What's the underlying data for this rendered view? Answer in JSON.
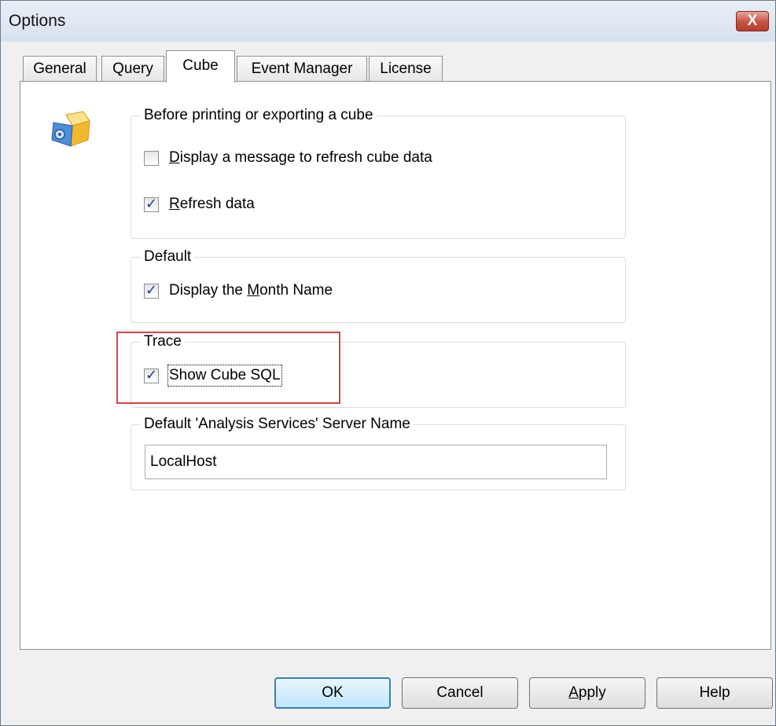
{
  "window": {
    "title": "Options",
    "close_glyph": "X"
  },
  "tabs": [
    {
      "label": "General",
      "active": false
    },
    {
      "label": "Query",
      "active": false
    },
    {
      "label": "Cube",
      "active": true
    },
    {
      "label": "Event Manager",
      "active": false
    },
    {
      "label": "License",
      "active": false
    }
  ],
  "groups": {
    "before_print": {
      "legend": "Before printing or exporting a cube",
      "display_message": {
        "mnemonic": "D",
        "rest": "isplay a message to refresh cube data",
        "checked": false
      },
      "refresh_data": {
        "mnemonic": "R",
        "rest": "efresh data",
        "checked": true
      }
    },
    "default": {
      "legend": "Default",
      "month_name": {
        "pre": "Display the ",
        "mnemonic": "M",
        "rest": "onth Name",
        "checked": true
      }
    },
    "trace": {
      "legend": "Trace",
      "show_sql": {
        "label": "Show Cube SQL",
        "checked": true
      }
    },
    "server": {
      "legend_pre": "Default  '",
      "legend_mnemonic": "A",
      "legend_rest": "nalysis Services' Server Name",
      "value": "LocalHost"
    }
  },
  "buttons": {
    "ok": "OK",
    "cancel": "Cancel",
    "apply_mnemonic": "A",
    "apply_rest": "pply",
    "help": "Help"
  },
  "icons": {
    "cube": "cube-icon",
    "close": "close-icon"
  },
  "colors": {
    "highlight_box": "#e04040",
    "default_button_border": "#3c7fb1"
  }
}
